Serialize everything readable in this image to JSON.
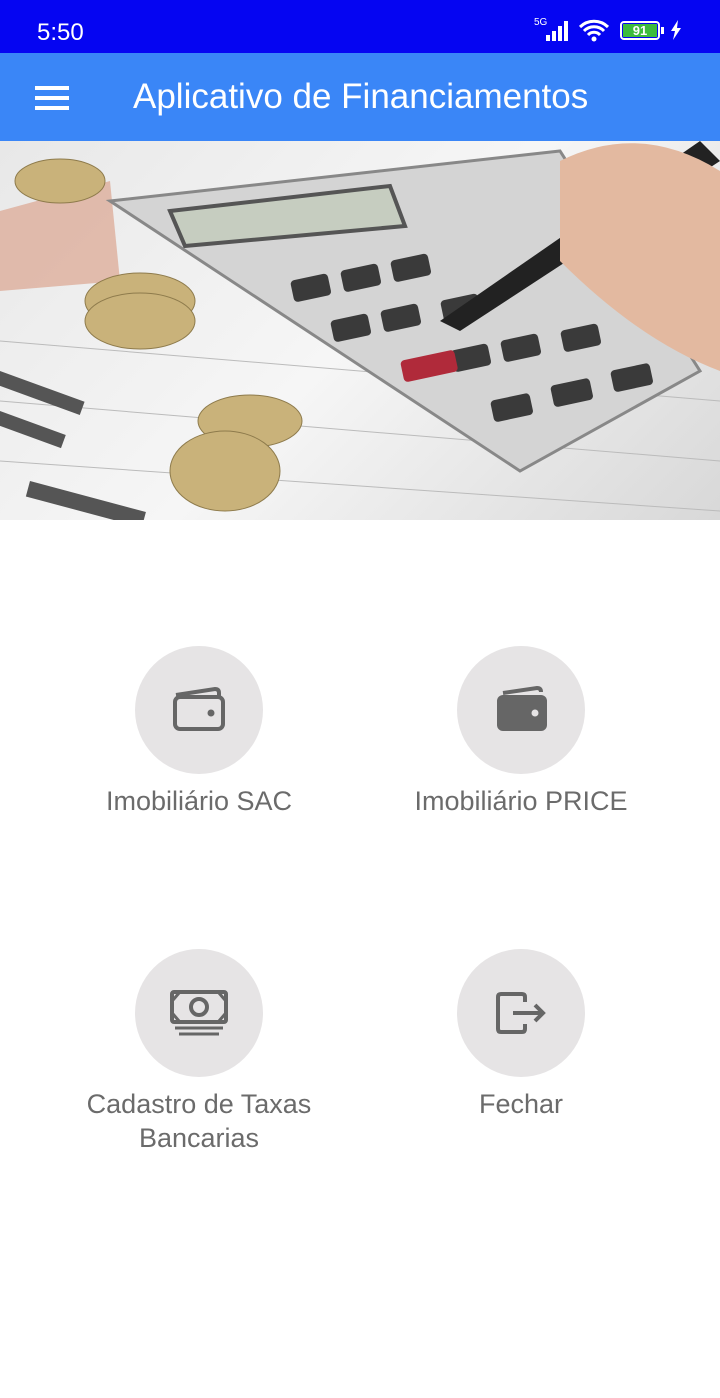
{
  "status_bar": {
    "time": "5:50",
    "network": "5G",
    "battery": "91"
  },
  "app_bar": {
    "title": "Aplicativo de Financiamentos",
    "menu_icon": "hamburger-menu-icon"
  },
  "hero": {
    "icon": "calculator-coins-photo"
  },
  "menu": [
    {
      "label": "Imobiliário SAC",
      "icon": "wallet-outline-icon"
    },
    {
      "label": "Imobiliário PRICE",
      "icon": "wallet-filled-icon"
    },
    {
      "label_line1": "Cadastro de Taxas",
      "label_line2": "Bancarias",
      "icon": "money-bill-icon"
    },
    {
      "label": "Fechar",
      "icon": "exit-icon"
    }
  ],
  "colors": {
    "status_bar": "#0505f2",
    "app_bar": "#3a86f7",
    "circle": "#e6e4e5",
    "icon": "#666666"
  }
}
